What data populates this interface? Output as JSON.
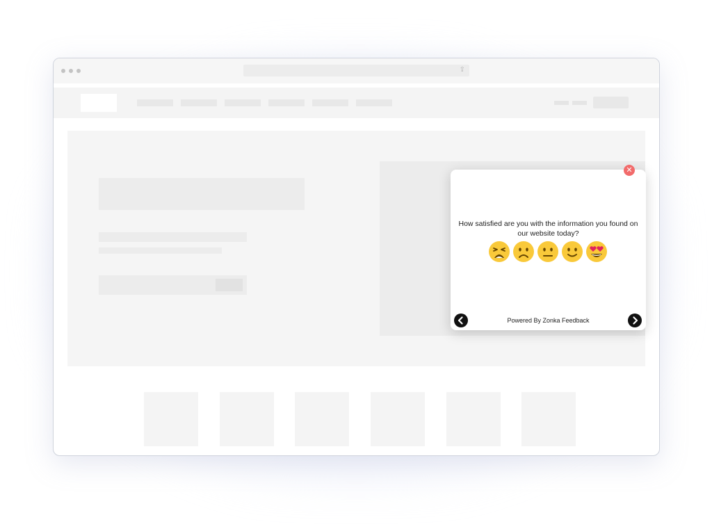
{
  "survey": {
    "question": "How satisfied are you with the information you found on our website today?",
    "ratings": [
      {
        "icon": "tired-face-icon",
        "name": "emoji-tired-face"
      },
      {
        "icon": "frowning-face-icon",
        "name": "emoji-frowning-face"
      },
      {
        "icon": "neutral-face-icon",
        "name": "emoji-neutral-face"
      },
      {
        "icon": "slightly-smiling-face-icon",
        "name": "emoji-slightly-smiling-face"
      },
      {
        "icon": "heart-eyes-face-icon",
        "name": "emoji-heart-eyes-face"
      }
    ],
    "footer": "Powered By Zonka Feedback",
    "close_symbol": "✕"
  },
  "colors": {
    "close_red": "#f26b6b",
    "emoji_yellow": "#f9c93a",
    "nav_black": "#111111",
    "placeholder_gray": "#ececec"
  }
}
